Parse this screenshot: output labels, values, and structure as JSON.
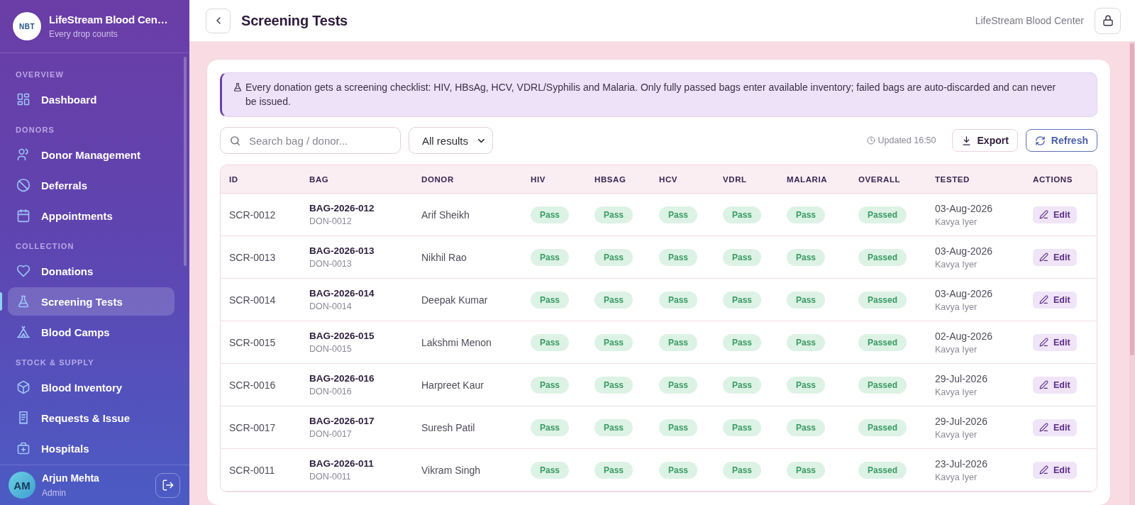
{
  "sidebar": {
    "brand": {
      "logo": "NBT",
      "title": "LifeStream Blood Cen…",
      "subtitle": "Every drop counts"
    },
    "sections": [
      {
        "label": "OVERVIEW",
        "items": [
          {
            "label": "Dashboard",
            "selected": false
          }
        ]
      },
      {
        "label": "DONORS",
        "items": [
          {
            "label": "Donor Management",
            "selected": false
          },
          {
            "label": "Deferrals",
            "selected": false
          },
          {
            "label": "Appointments",
            "selected": false
          }
        ]
      },
      {
        "label": "COLLECTION",
        "items": [
          {
            "label": "Donations",
            "selected": false
          },
          {
            "label": "Screening Tests",
            "selected": true
          },
          {
            "label": "Blood Camps",
            "selected": false
          }
        ]
      },
      {
        "label": "STOCK & SUPPLY",
        "items": [
          {
            "label": "Blood Inventory",
            "selected": false
          },
          {
            "label": "Requests & Issue",
            "selected": false
          },
          {
            "label": "Hospitals",
            "selected": false
          }
        ]
      }
    ],
    "user": {
      "initials": "AM",
      "name": "Arjun Mehta",
      "role": "Admin"
    }
  },
  "header": {
    "title": "Screening Tests",
    "org": "LifeStream Blood Center"
  },
  "notice": "Every donation gets a screening checklist: HIV, HBsAg, HCV, VDRL/Syphilis and Malaria. Only fully passed bags enter available inventory; failed bags are auto-discarded and can never be issued.",
  "toolbar": {
    "search": {
      "placeholder": "Search bag / donor..."
    },
    "filter": {
      "value": "All results"
    },
    "updated": "Updated 16:50",
    "buttons": [
      {
        "label": "Export",
        "kind": "export"
      },
      {
        "label": "Refresh",
        "kind": "refresh"
      }
    ]
  },
  "table": {
    "columns": [
      "ID",
      "BAG",
      "DONOR",
      "HIV",
      "HBSAG",
      "HCV",
      "VDRL",
      "MALARIA",
      "OVERALL",
      "TESTED",
      "ACTIONS"
    ],
    "rows": [
      {
        "id": "SCR-0012",
        "bag": "BAG-2026-012",
        "donor_id": "DON-0012",
        "donor": "Arif Sheikh",
        "results": [
          "Pass",
          "Pass",
          "Pass",
          "Pass",
          "Pass"
        ],
        "overall": "Passed",
        "tested": "03-Aug-2026",
        "tested_by": "Kavya Iyer",
        "action": "Edit"
      },
      {
        "id": "SCR-0013",
        "bag": "BAG-2026-013",
        "donor_id": "DON-0013",
        "donor": "Nikhil Rao",
        "results": [
          "Pass",
          "Pass",
          "Pass",
          "Pass",
          "Pass"
        ],
        "overall": "Passed",
        "tested": "03-Aug-2026",
        "tested_by": "Kavya Iyer",
        "action": "Edit"
      },
      {
        "id": "SCR-0014",
        "bag": "BAG-2026-014",
        "donor_id": "DON-0014",
        "donor": "Deepak Kumar",
        "results": [
          "Pass",
          "Pass",
          "Pass",
          "Pass",
          "Pass"
        ],
        "overall": "Passed",
        "tested": "03-Aug-2026",
        "tested_by": "Kavya Iyer",
        "action": "Edit"
      },
      {
        "id": "SCR-0015",
        "bag": "BAG-2026-015",
        "donor_id": "DON-0015",
        "donor": "Lakshmi Menon",
        "results": [
          "Pass",
          "Pass",
          "Pass",
          "Pass",
          "Pass"
        ],
        "overall": "Passed",
        "tested": "02-Aug-2026",
        "tested_by": "Kavya Iyer",
        "action": "Edit"
      },
      {
        "id": "SCR-0016",
        "bag": "BAG-2026-016",
        "donor_id": "DON-0016",
        "donor": "Harpreet Kaur",
        "results": [
          "Pass",
          "Pass",
          "Pass",
          "Pass",
          "Pass"
        ],
        "overall": "Passed",
        "tested": "29-Jul-2026",
        "tested_by": "Kavya Iyer",
        "action": "Edit"
      },
      {
        "id": "SCR-0017",
        "bag": "BAG-2026-017",
        "donor_id": "DON-0017",
        "donor": "Suresh Patil",
        "results": [
          "Pass",
          "Pass",
          "Pass",
          "Pass",
          "Pass"
        ],
        "overall": "Passed",
        "tested": "29-Jul-2026",
        "tested_by": "Kavya Iyer",
        "action": "Edit"
      },
      {
        "id": "SCR-0011",
        "bag": "BAG-2026-011",
        "donor_id": "DON-0011",
        "donor": "Vikram Singh",
        "results": [
          "Pass",
          "Pass",
          "Pass",
          "Pass",
          "Pass"
        ],
        "overall": "Passed",
        "tested": "23-Jul-2026",
        "tested_by": "Kavya Iyer",
        "action": "Edit"
      }
    ]
  }
}
